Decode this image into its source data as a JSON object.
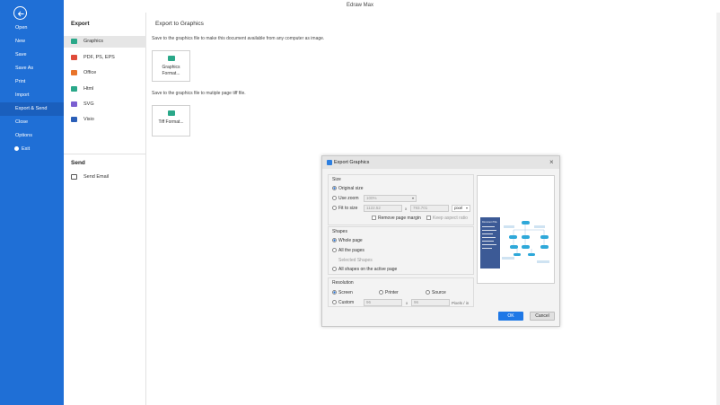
{
  "app_title": "Edraw Max",
  "nav": {
    "items": [
      {
        "label": "Open"
      },
      {
        "label": "New"
      },
      {
        "label": "Save"
      },
      {
        "label": "Save As"
      },
      {
        "label": "Print"
      },
      {
        "label": "Import"
      },
      {
        "label": "Export & Send"
      },
      {
        "label": "Close"
      },
      {
        "label": "Options"
      },
      {
        "label": "Exit"
      }
    ],
    "active": "Export & Send"
  },
  "export_panel": {
    "title": "Export",
    "items": [
      {
        "label": "Graphics",
        "icon": "graphics-icon",
        "color": "#2aa889"
      },
      {
        "label": "PDF, PS, EPS",
        "icon": "pdf-icon",
        "color": "#e04b3a"
      },
      {
        "label": "Office",
        "icon": "office-icon",
        "color": "#e8742a"
      },
      {
        "label": "Html",
        "icon": "html-icon",
        "color": "#2aa889"
      },
      {
        "label": "SVG",
        "icon": "svg-icon",
        "color": "#7b5fd1"
      },
      {
        "label": "Visio",
        "icon": "visio-icon",
        "color": "#2b5fb8"
      }
    ],
    "send_title": "Send",
    "send_items": [
      {
        "label": "Send Email",
        "icon": "email-icon"
      }
    ]
  },
  "main": {
    "title": "Export to Graphics",
    "desc1": "Save to the graphics file to make this document available from any computer as image.",
    "card1": "Graphics Format...",
    "desc2": "Save to the graphics file to mutiple page tiff file.",
    "card2": "Tiff Format..."
  },
  "dialog": {
    "title": "Export Graphics",
    "size": {
      "label": "Size",
      "original": "Original size",
      "use_zoom": "Use zoom",
      "zoom_value": "100%",
      "fit_to_size": "Fit to size",
      "width": "1122.52",
      "x": "x",
      "height": "793.701",
      "unit": "pixel",
      "remove_margin": "Remove page margin",
      "keep_ratio": "Keep aspect ratio"
    },
    "shapes": {
      "label": "Shapes",
      "whole_page": "Whole page",
      "all_pages": "All the pages",
      "selected": "Selected Shapes",
      "all_active": "All shapes on the active page"
    },
    "resolution": {
      "label": "Resolution",
      "screen": "Screen",
      "printer": "Printer",
      "source": "Source",
      "custom": "Custom",
      "dpi_x": "96",
      "x": "x",
      "dpi_y": "96",
      "unit": "Pixels / in"
    },
    "preview_title": "Document Title",
    "ok": "OK",
    "cancel": "Cancel"
  },
  "colors": {
    "nav_blue": "#1f6fd6",
    "accent": "#1f78e6"
  }
}
